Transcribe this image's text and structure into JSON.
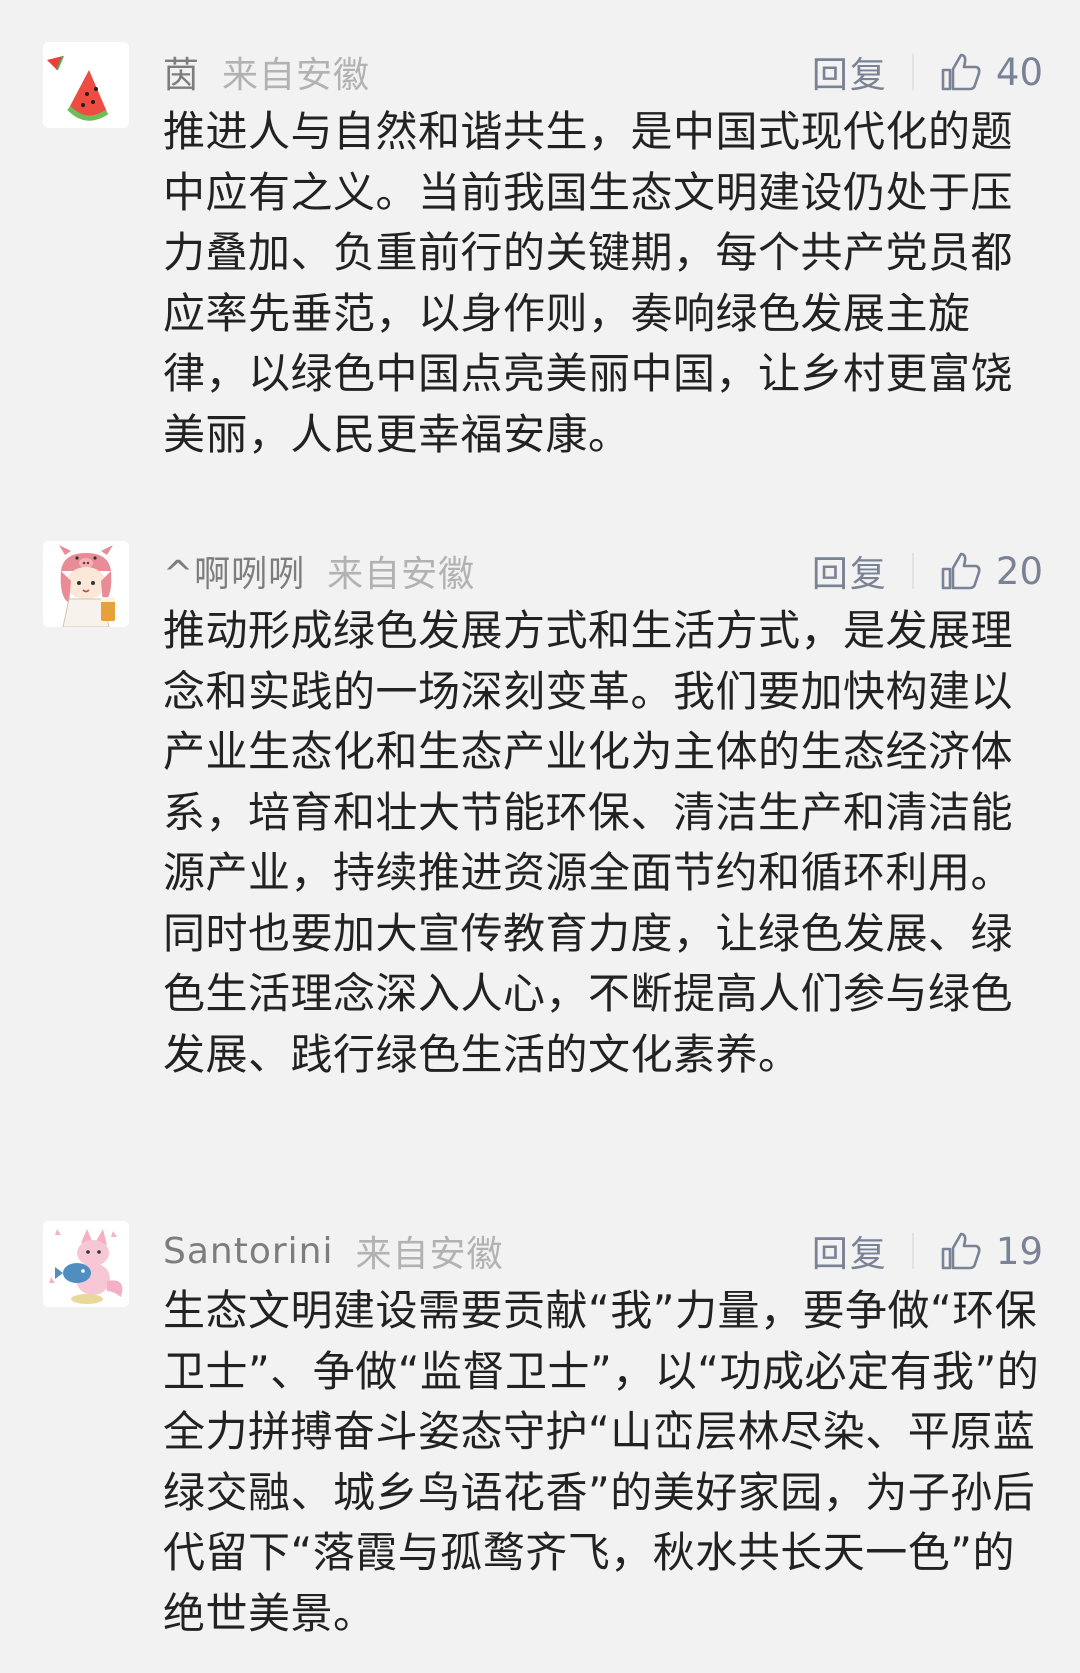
{
  "comments": [
    {
      "nickname": "茵",
      "location": "来自安徽",
      "reply_label": "回复",
      "likes": "40",
      "avatar_icon": "watermelon-icon",
      "text": "推进人与自然和谐共生，是中国式现代化的题中应有之义。当前我国生态文明建设仍处于压力叠加、负重前行的关键期，每个共产党员都应率先垂范，以身作则，奏响绿色发展主旋律，以绿色中国点亮美丽中国，让乡村更富饶美丽，人民更幸福安康。"
    },
    {
      "nickname": "^啊咧咧",
      "location": "来自安徽",
      "reply_label": "回复",
      "likes": "20",
      "avatar_icon": "cartoon-pig-hat-avatar-icon",
      "text": "推动形成绿色发展方式和生活方式，是发展理念和实践的一场深刻变革。我们要加快构建以产业生态化和生态产业化为主体的生态经济体系，培育和壮大节能环保、清洁生产和清洁能源产业，持续推进资源全面节约和循环利用。同时也要加大宣传教育力度，让绿色发展、绿色生活理念深入人心，不断提高人们参与绿色发展、践行绿色生活的文化素养。"
    },
    {
      "nickname": "Santorini",
      "location": "来自安徽",
      "reply_label": "回复",
      "likes": "19",
      "avatar_icon": "cartoon-fox-fish-avatar-icon",
      "text": "生态文明建设需要贡献“我”力量，要争做“环保卫士”、争做“监督卫士”，以“功成必定有我”的全力拼搏奋斗姿态守护“山峦层林尽染、平原蓝绿交融、城乡鸟语花香”的美好家园，为子孙后代留下“落霞与孤鹜齐飞，秋水共长天一色”的绝世美景。"
    }
  ]
}
